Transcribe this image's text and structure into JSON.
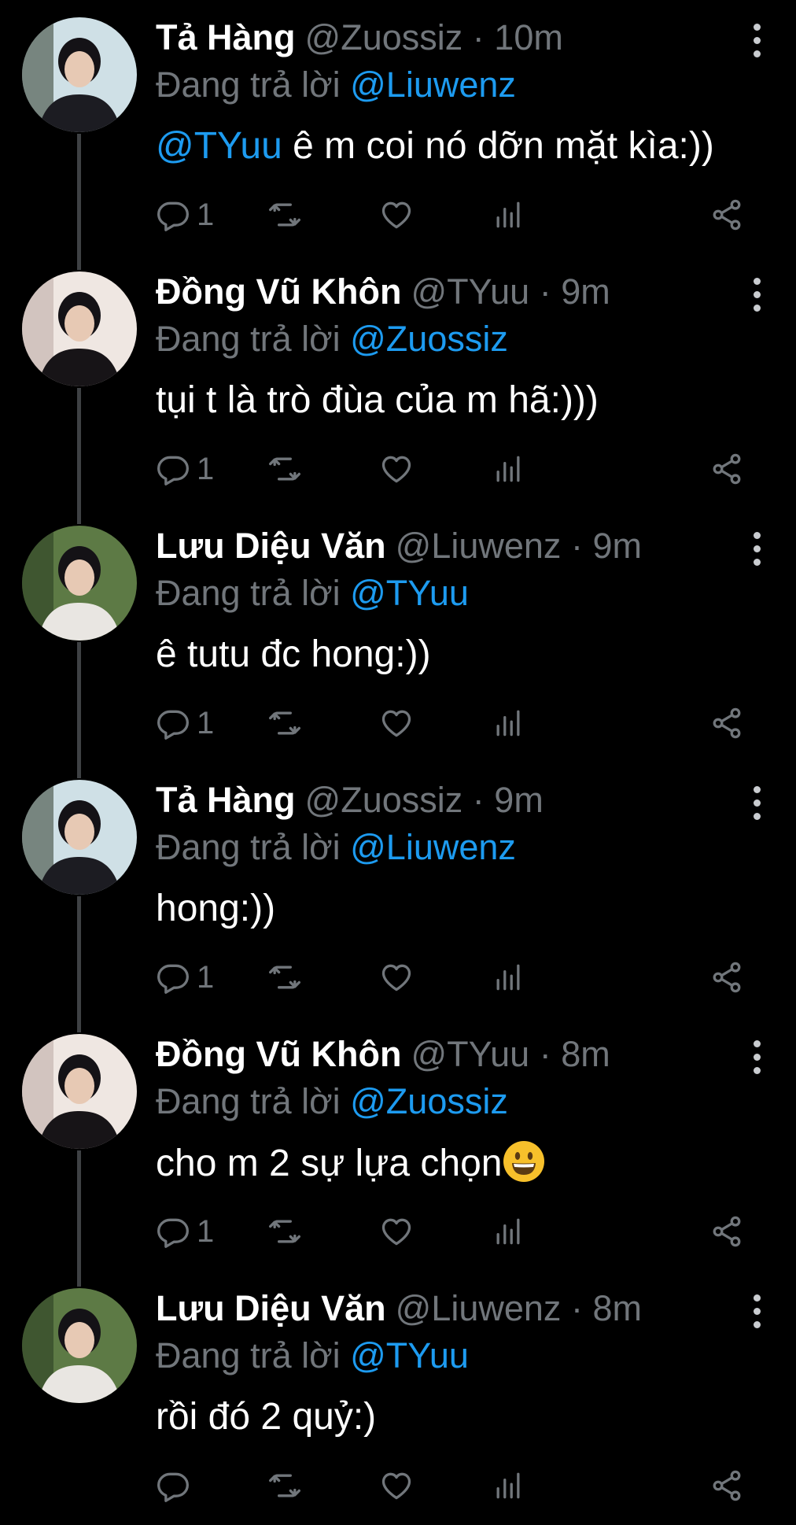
{
  "reply_prefix": "Đang trả lời",
  "tweets": [
    {
      "name": "Tả Hàng",
      "handle": "@Zuossiz",
      "dot": "·",
      "time": "10m",
      "reply_to": "@Liuwenz",
      "mention": "@TYuu",
      "text": " ê m coi nó dỡn mặt kìa:))",
      "reply_count": "1",
      "avatar_colors": [
        "#cfe0e6",
        "#2f3a2a",
        "#1c1c22"
      ]
    },
    {
      "name": "Đồng Vũ Khôn",
      "handle": "@TYuu",
      "dot": "·",
      "time": "9m",
      "reply_to": "@Zuossiz",
      "mention": "",
      "text": "tụi t là trò đùa của m hã:)))",
      "reply_count": "1",
      "avatar_colors": [
        "#efe7e2",
        "#b9a7a2",
        "#171417"
      ]
    },
    {
      "name": "Lưu Diệu Văn",
      "handle": "@Liuwenz",
      "dot": "·",
      "time": "9m",
      "reply_to": "@TYuu",
      "mention": "",
      "text": "ê tutu đc hong:))",
      "reply_count": "1",
      "avatar_colors": [
        "#5d7a45",
        "#26381f",
        "#e9e6e2"
      ]
    },
    {
      "name": "Tả Hàng",
      "handle": "@Zuossiz",
      "dot": "·",
      "time": "9m",
      "reply_to": "@Liuwenz",
      "mention": "",
      "text": "hong:))",
      "reply_count": "1",
      "avatar_colors": [
        "#cfe0e6",
        "#2f3a2a",
        "#1c1c22"
      ]
    },
    {
      "name": "Đồng Vũ Khôn",
      "handle": "@TYuu",
      "dot": "·",
      "time": "8m",
      "reply_to": "@Zuossiz",
      "mention": "",
      "text": "cho m 2 sự lựa chọn",
      "emoji": "grinning-face-emoji",
      "reply_count": "1",
      "avatar_colors": [
        "#efe7e2",
        "#b9a7a2",
        "#171417"
      ]
    },
    {
      "name": "Lưu Diệu Văn",
      "handle": "@Liuwenz",
      "dot": "·",
      "time": "8m",
      "reply_to": "@TYuu",
      "mention": "",
      "text": "rồi đó 2 quỷ:)",
      "reply_count": "",
      "avatar_colors": [
        "#5d7a45",
        "#26381f",
        "#e9e6e2"
      ]
    }
  ],
  "icons": {
    "reply": "speech-bubble-icon",
    "retweet": "retweet-icon",
    "like": "heart-icon",
    "views": "bar-chart-icon",
    "share": "share-icon",
    "menu": "more-vertical-icon"
  },
  "colors": {
    "background": "#000000",
    "text": "#ffffff",
    "muted": "#71767b",
    "link": "#1d9bf0",
    "thread_line": "#3e4144"
  }
}
